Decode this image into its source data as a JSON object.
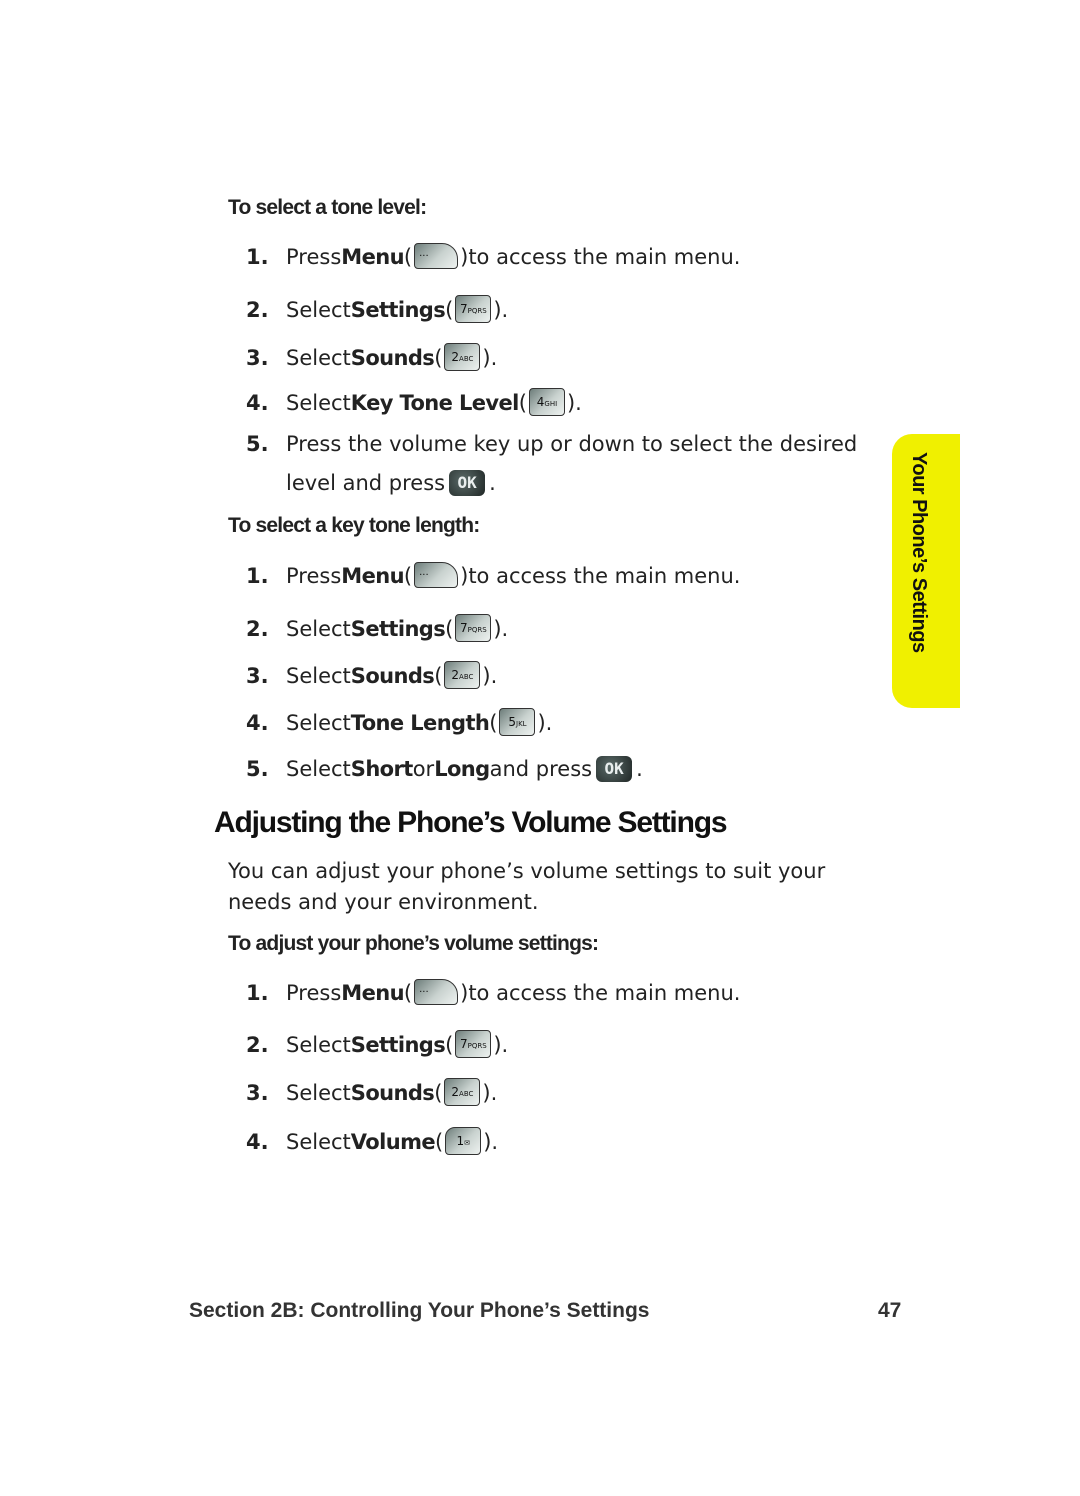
{
  "sections": [
    {
      "subhead": "To select a tone level:",
      "steps": [
        {
          "num": "1.",
          "pre": "Press ",
          "bold": "Menu",
          "post_key": " to access the main menu.",
          "key": {
            "type": "menu",
            "label": "···"
          }
        },
        {
          "num": "2.",
          "pre": "Select ",
          "bold": "Settings",
          "post_key": ".",
          "key": {
            "type": "digit",
            "digit": "7",
            "letters": "PQRS"
          }
        },
        {
          "num": "3.",
          "pre": "Select ",
          "bold": "Sounds",
          "post_key": ".",
          "key": {
            "type": "digit",
            "digit": "2",
            "letters": "ABC"
          }
        },
        {
          "num": "4.",
          "pre": "Select ",
          "bold": "Key Tone Level",
          "post_key": ".",
          "key": {
            "type": "digit",
            "digit": "4",
            "letters": "GHI"
          }
        },
        {
          "num": "5.",
          "line1": "Press the volume key up or down to select the desired",
          "line2": "level and press",
          "key": {
            "type": "ok",
            "label": "OK"
          },
          "end": "."
        }
      ]
    },
    {
      "subhead": "To select a key tone length:",
      "steps": [
        {
          "num": "1.",
          "pre": "Press ",
          "bold": "Menu",
          "post_key": " to access the main menu.",
          "key": {
            "type": "menu",
            "label": "···"
          }
        },
        {
          "num": "2.",
          "pre": "Select ",
          "bold": "Settings",
          "post_key": ".",
          "key": {
            "type": "digit",
            "digit": "7",
            "letters": "PQRS"
          }
        },
        {
          "num": "3.",
          "pre": "Select ",
          "bold": "Sounds",
          "post_key": ".",
          "key": {
            "type": "digit",
            "digit": "2",
            "letters": "ABC"
          }
        },
        {
          "num": "4.",
          "pre": "Select ",
          "bold": "Tone Length",
          "post_key": ".",
          "key": {
            "type": "digit",
            "digit": "5",
            "letters": "JKL"
          }
        },
        {
          "num": "5.",
          "pre": "Select ",
          "bold": "Short",
          "mid": " or ",
          "bold2": "Long",
          "post": " and press",
          "key": {
            "type": "ok",
            "label": "OK"
          },
          "end": "."
        }
      ]
    },
    {
      "heading": "Adjusting the Phone’s Volume Settings",
      "paragraph": "You can adjust your phone’s volume settings to suit your needs and your environment.",
      "subhead": "To adjust your phone’s volume settings:",
      "steps": [
        {
          "num": "1.",
          "pre": "Press ",
          "bold": "Menu",
          "post_key": " to access the main menu.",
          "key": {
            "type": "menu",
            "label": "···"
          }
        },
        {
          "num": "2.",
          "pre": "Select ",
          "bold": "Settings",
          "post_key": ".",
          "key": {
            "type": "digit",
            "digit": "7",
            "letters": "PQRS"
          }
        },
        {
          "num": "3.",
          "pre": "Select ",
          "bold": "Sounds",
          "post_key": ".",
          "key": {
            "type": "digit",
            "digit": "2",
            "letters": "ABC"
          }
        },
        {
          "num": "4.",
          "pre": "Select ",
          "bold": "Volume",
          "post_key": ".",
          "key": {
            "type": "digit",
            "digit": "1",
            "letters": "✉"
          }
        }
      ]
    }
  ],
  "side_tab": {
    "label": "Your Phone’s Settings",
    "color": "#f0f000"
  },
  "footer": {
    "section": "Section 2B: Controlling Your Phone’s Settings",
    "page": "47"
  },
  "punct": {
    "open": " (",
    "close": ")"
  }
}
